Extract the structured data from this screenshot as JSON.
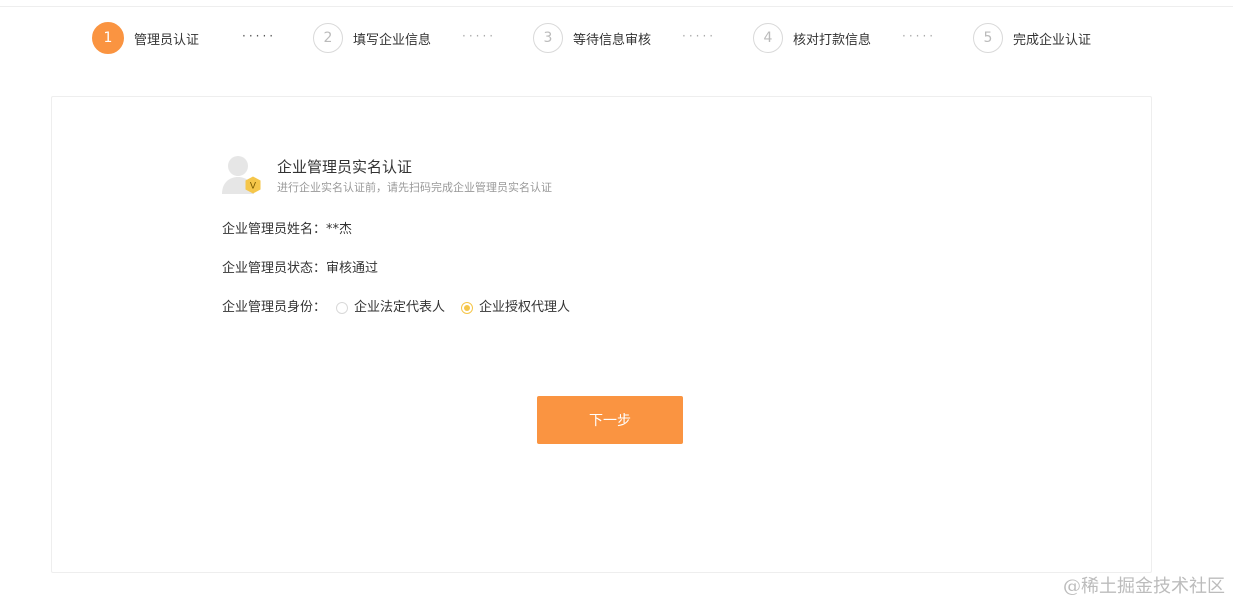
{
  "steps": [
    {
      "number": "1",
      "label": "管理员认证",
      "active": true
    },
    {
      "number": "2",
      "label": "填写企业信息",
      "active": false
    },
    {
      "number": "3",
      "label": "等待信息审核",
      "active": false
    },
    {
      "number": "4",
      "label": "核对打款信息",
      "active": false
    },
    {
      "number": "5",
      "label": "完成企业认证",
      "active": false
    }
  ],
  "step_separator": "·····",
  "header": {
    "title": "企业管理员实名认证",
    "subtitle": "进行企业实名认证前，请先扫码完成企业管理员实名认证",
    "badge_letter": "V"
  },
  "fields": {
    "name_label": "企业管理员姓名：",
    "name_value": "**杰",
    "status_label": "企业管理员状态：",
    "status_value": "审核通过",
    "identity_label": "企业管理员身份：",
    "identity_options": [
      {
        "label": "企业法定代表人",
        "checked": false
      },
      {
        "label": "企业授权代理人",
        "checked": true
      }
    ]
  },
  "next_button": "下一步",
  "watermark": "@稀土掘金技术社区",
  "colors": {
    "accent": "#fa9441",
    "radio_checked": "#f5c64a",
    "badge": "#f5c64a"
  },
  "icons": {
    "avatar": "user-avatar-icon",
    "badge": "verified-badge-icon"
  }
}
